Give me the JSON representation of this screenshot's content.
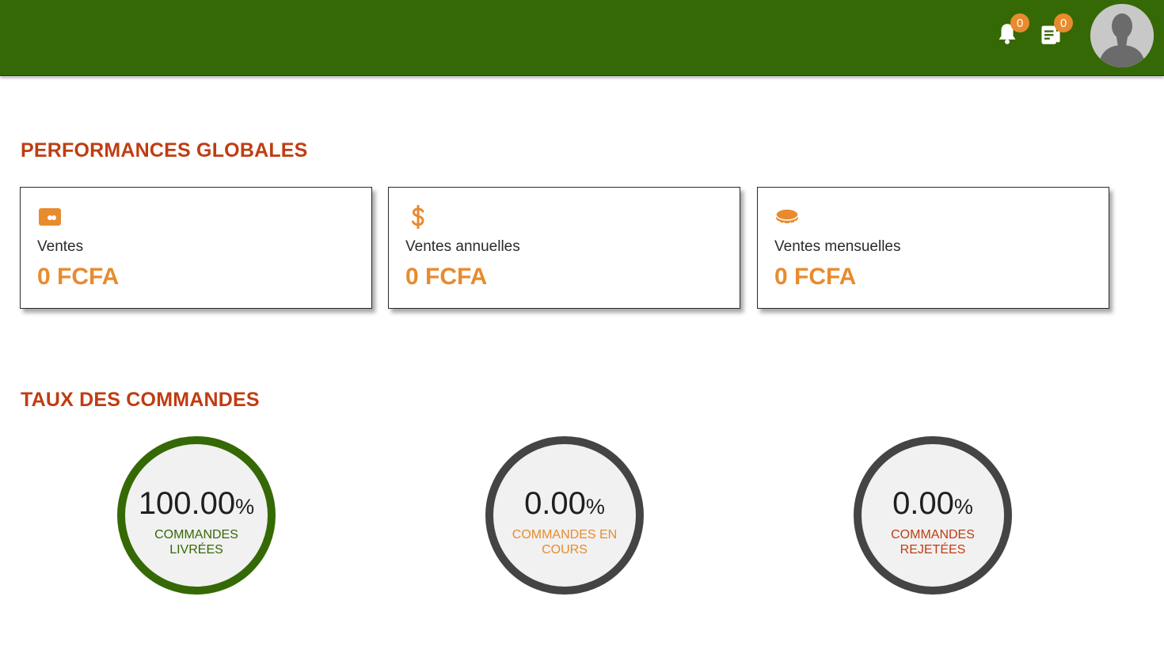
{
  "header": {
    "notifications_count": "0",
    "orders_count": "0",
    "colors": {
      "bar": "#356905",
      "badge": "#e88b2e"
    }
  },
  "performances": {
    "title": "PERFORMANCES GLOBALES",
    "cards": [
      {
        "icon": "ticket-icon",
        "label": "Ventes",
        "value": "0 FCFA"
      },
      {
        "icon": "dollar-icon",
        "label": "Ventes annuelles",
        "value": "0 FCFA"
      },
      {
        "icon": "coins-icon",
        "label": "Ventes mensuelles",
        "value": "0 FCFA"
      }
    ]
  },
  "commandes": {
    "title": "TAUX DES COMMANDES",
    "rates": [
      {
        "value": "100.00",
        "unit": "%",
        "label": "COMMANDES LIVRÉES",
        "color": "#356905",
        "fraction": 1.0
      },
      {
        "value": "0.00",
        "unit": "%",
        "label": "COMMANDES EN COURS",
        "color": "#e88b2e",
        "fraction": 0.0
      },
      {
        "value": "0.00",
        "unit": "%",
        "label": "COMMANDES REJETÉES",
        "color": "#bf3d12",
        "fraction": 0.0
      }
    ]
  }
}
